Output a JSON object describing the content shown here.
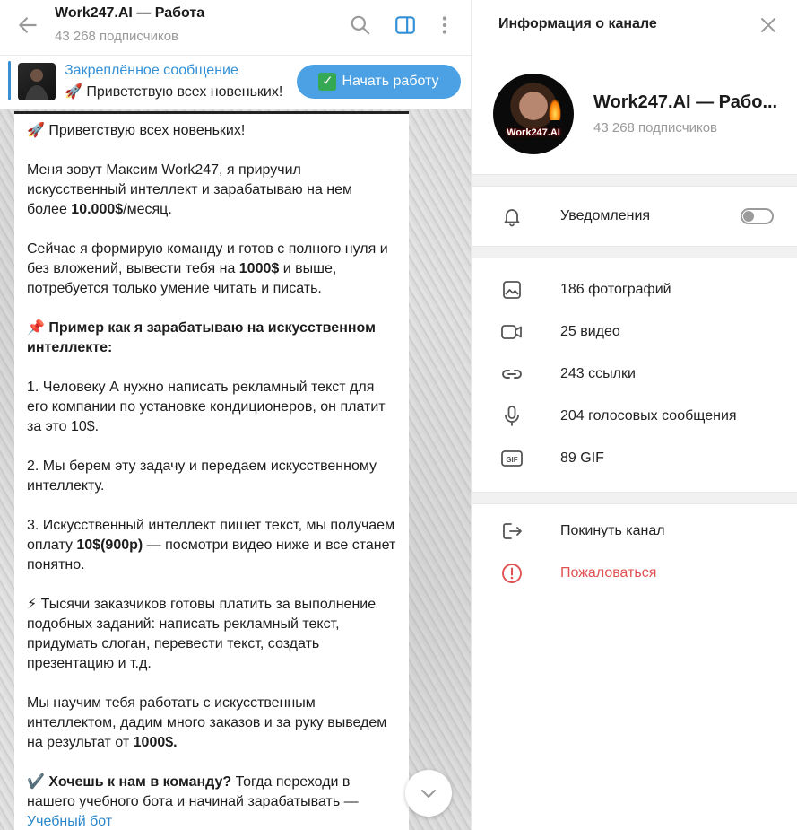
{
  "chat": {
    "title": "Work247.AI — Работа",
    "subscribers": "43 268 подписчиков",
    "pinned": {
      "title": "Закреплённое сообщение",
      "text": "🚀 Приветствую всех новеньких!",
      "button": "Начать работу"
    },
    "message": {
      "p1": "🚀 Приветствую всех новеньких!",
      "p2_a": "Меня зовут Максим Work247, я приручил искусственный интеллект и зарабатываю на нем более ",
      "p2_b": "10.000$",
      "p2_c": "/месяц.",
      "p3_a": "Сейчас я формирую команду и готов с полного нуля и без вложений, вывести тебя на ",
      "p3_b": "1000$",
      "p3_c": " и выше, потребуется только умение читать и писать.",
      "p4": "📌 Пример как я зарабатываю на искусственном интеллекте:",
      "p5": "1. Человеку А нужно написать рекламный текст для его компании по установке кондиционеров, он платит за это 10$.",
      "p6": "2. Мы берем эту задачу и передаем искусственному интеллекту.",
      "p7_a": "3. Искусственный интеллект пишет текст, мы получаем оплату ",
      "p7_b": "10$(900р)",
      "p7_c": " — посмотри видео ниже и все станет понятно.",
      "p8": "⚡ Тысячи заказчиков готовы платить за выполнение подобных заданий: написать рекламный текст, придумать слоган, перевести текст, создать презентацию и т.д.",
      "p9_a": "Мы научим тебя работать с искусственным интеллектом, дадим много заказов и за руку выведем на результат от ",
      "p9_b": "1000$.",
      "p10_a": "✔️ ",
      "p10_b": "Хочешь к нам в команду?",
      "p10_c": " Тогда переходи в нашего учебного бота и начинай зарабатывать — ",
      "p10_link": "Учебный бот"
    }
  },
  "info": {
    "header": "Информация о канале",
    "channel_name": "Work247.AI — Рабо...",
    "subscribers": "43 268 подписчиков",
    "avatar_brand": "Work247.AI",
    "notifications": "Уведомления",
    "notifications_on": false,
    "media": [
      {
        "label": "186 фотографий",
        "icon": "photo-icon"
      },
      {
        "label": "25 видео",
        "icon": "video-icon"
      },
      {
        "label": "243 ссылки",
        "icon": "link-icon"
      },
      {
        "label": "204 голосовых сообщения",
        "icon": "microphone-icon"
      },
      {
        "label": "89 GIF",
        "icon": "gif-icon"
      }
    ],
    "leave": "Покинуть канал",
    "report": "Пожаловаться"
  },
  "colors": {
    "accent": "#3390d6",
    "button": "#4ba1e3",
    "danger": "#e05252"
  }
}
